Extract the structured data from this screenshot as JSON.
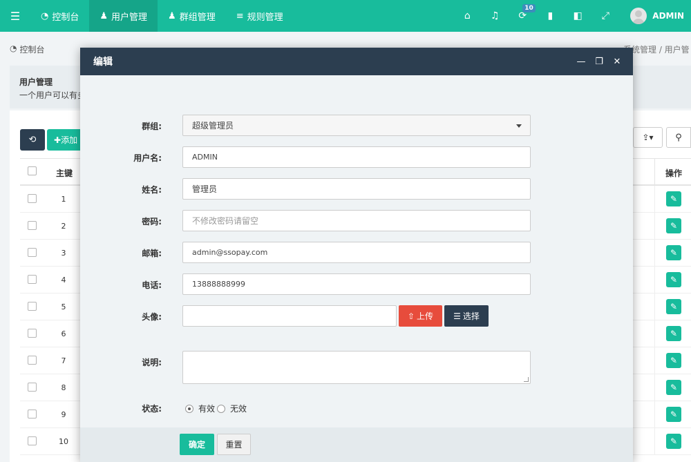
{
  "topnav": {
    "tabs": [
      {
        "label": "控制台",
        "icon": "dashboard-icon"
      },
      {
        "label": "用户管理",
        "icon": "user-icon"
      },
      {
        "label": "群组管理",
        "icon": "users-icon"
      },
      {
        "label": "规则管理",
        "icon": "list-icon"
      }
    ],
    "notification_count": "10",
    "username": "ADMIN"
  },
  "breadcrumb": {
    "home": "控制台",
    "trail": "系统管理 / 用户管"
  },
  "intro": {
    "title": "用户管理",
    "description": "一个用户可以有多"
  },
  "toolbar": {
    "add_label": "添加"
  },
  "table": {
    "headers": {
      "id": "主键",
      "operation": "操作"
    },
    "rows": [
      "1",
      "2",
      "3",
      "4",
      "5",
      "6",
      "7",
      "8",
      "9",
      "10"
    ]
  },
  "dialog": {
    "title": "编辑",
    "fields": {
      "group": {
        "label": "群组:",
        "value": "超级管理员"
      },
      "username": {
        "label": "用户名:",
        "value": "ADMIN"
      },
      "nickname": {
        "label": "姓名:",
        "value": "管理员"
      },
      "password": {
        "label": "密码:",
        "placeholder": "不修改密码请留空"
      },
      "email": {
        "label": "邮箱:",
        "value": "admin@ssopay.com"
      },
      "phone": {
        "label": "电话:",
        "value": "13888888999"
      },
      "avatar": {
        "label": "头像:",
        "upload_label": "上传",
        "choose_label": "选择"
      },
      "description": {
        "label": "说明:"
      },
      "status": {
        "label": "状态:",
        "options": [
          "有效",
          "无效"
        ],
        "selected": "有效"
      }
    },
    "buttons": {
      "submit": "确定",
      "reset": "重置"
    }
  },
  "colors": {
    "primary": "#18bc9c",
    "dark": "#2c3e50",
    "danger": "#e74c3c"
  }
}
